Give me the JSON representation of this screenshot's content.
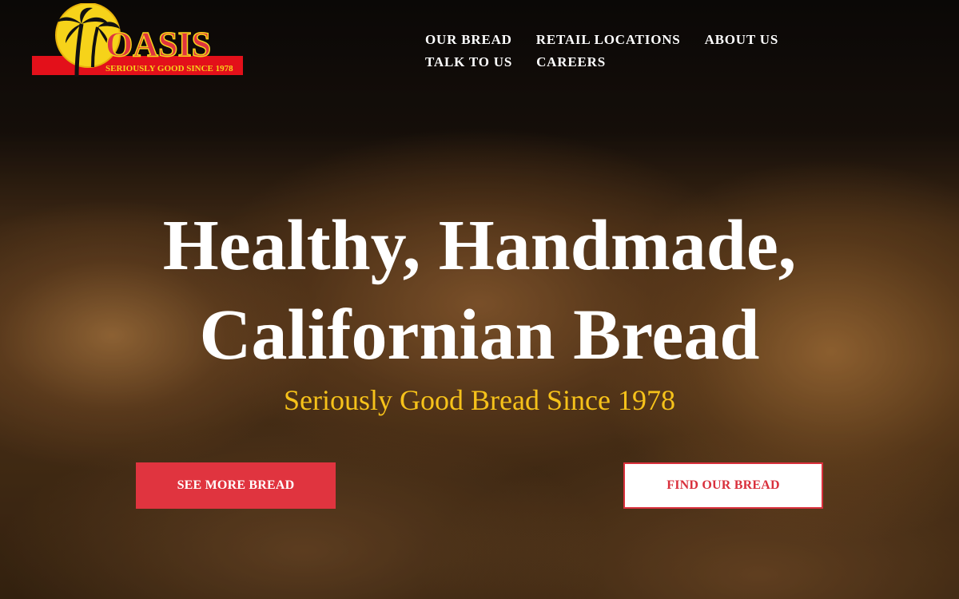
{
  "logo": {
    "brand": "OASIS",
    "slogan": "SERIOUSLY GOOD SINCE 1978",
    "icon": "palm-tree-sun-icon",
    "colors": {
      "sun": "#f6d31a",
      "wordmark": "#e0343f",
      "banner": "#e3101a"
    }
  },
  "nav": {
    "items": [
      {
        "label": "OUR BREAD"
      },
      {
        "label": "RETAIL LOCATIONS"
      },
      {
        "label": "ABOUT US"
      },
      {
        "label": "TALK TO US"
      },
      {
        "label": "CAREERS"
      }
    ]
  },
  "hero": {
    "headline_line1": "Healthy, Handmade,",
    "headline_line2": "Californian Bread",
    "tagline": "Seriously Good Bread Since 1978",
    "primary_button": "SEE MORE BREAD",
    "secondary_button": "FIND OUR BREAD"
  },
  "colors": {
    "accent_red": "#e0343f",
    "tagline_yellow": "#f6c21a",
    "text_white": "#ffffff"
  }
}
